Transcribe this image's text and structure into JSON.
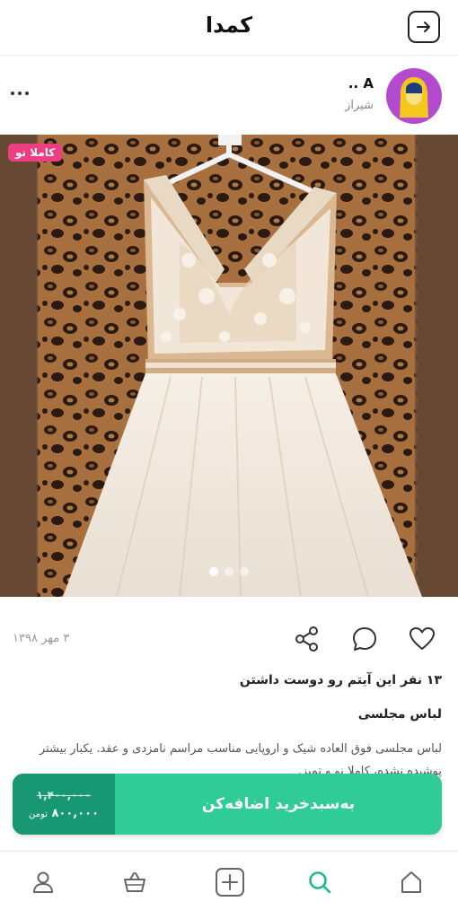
{
  "header": {
    "logo": "كمدا"
  },
  "seller": {
    "name": "A ..",
    "city": "شیراز"
  },
  "listing": {
    "badge": "کاملا نو",
    "date": "۳ مهر ۱۳۹۸",
    "likes_text": "۱۳ نفر این آیتم رو دوست داشتن",
    "title": "لباس مجلسی",
    "description": "لباس مجلسی فوق العاده شیک و اروپایی مناسب مراسم نامزدی و عقد. یکبار بیشتر پوشیده نشده، کاملا نو و تمیز.",
    "photo_count": 3,
    "active_photo": 1
  },
  "cart": {
    "button_label": "به‌سبدخرید اضافه‌کن",
    "old_price": "۱,۴۰۰,۰۰۰",
    "new_price": "۸۰۰,۰۰۰",
    "currency": "تومن"
  },
  "icons": {
    "back": "arrow-right-icon",
    "more": "more-dots-icon",
    "like": "heart-icon",
    "comment": "chat-bubble-icon",
    "share": "share-icon",
    "nav": [
      "home-icon",
      "search-icon",
      "add-icon",
      "basket-icon",
      "profile-icon"
    ]
  },
  "colors": {
    "accent": "#2fcc98",
    "accent_dark": "#179873",
    "badge": "#ee3e83",
    "active_nav": "#1fb889"
  }
}
